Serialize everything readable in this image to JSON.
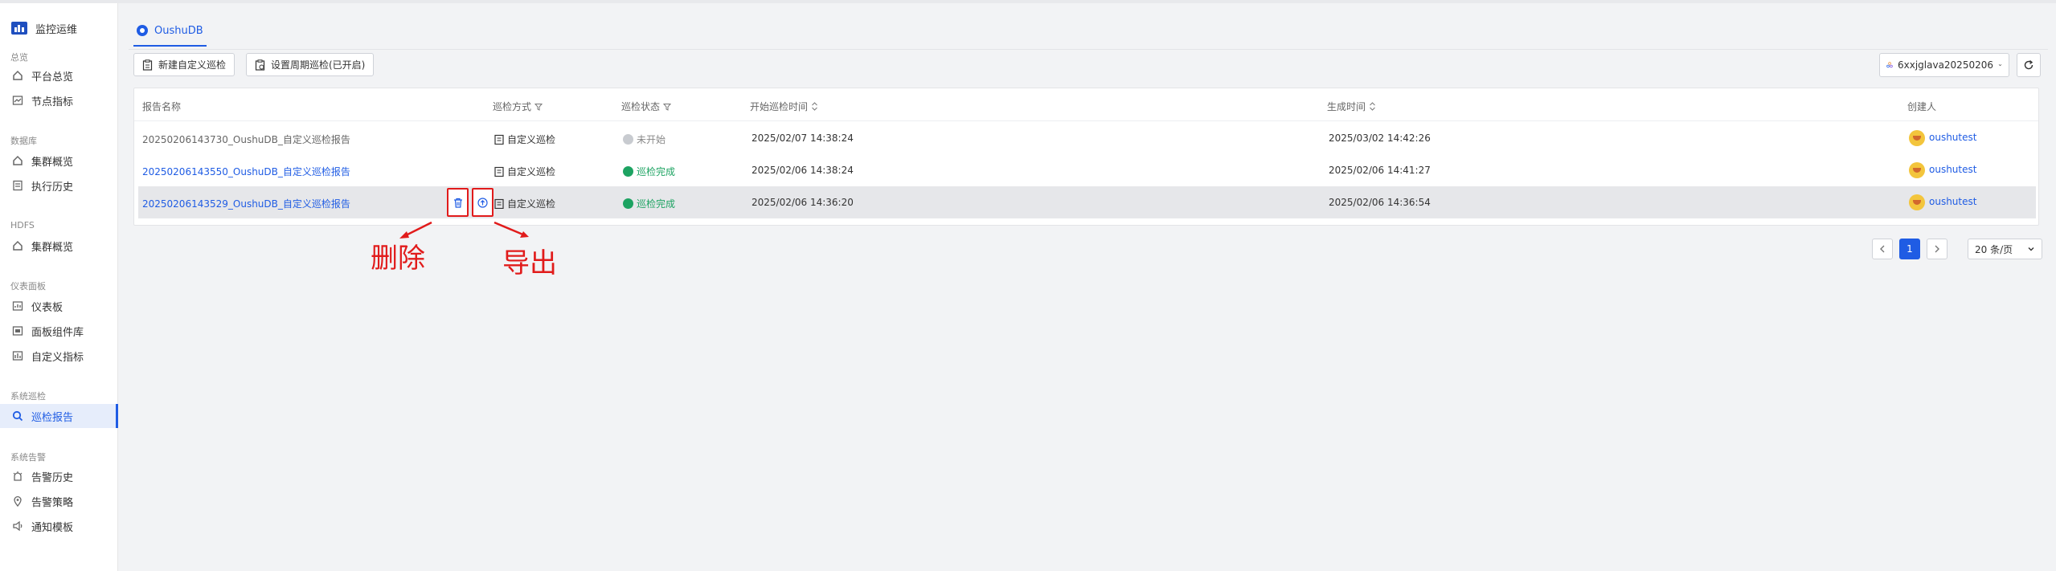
{
  "app": {
    "title": "监控运维"
  },
  "sidebar": {
    "groups": [
      {
        "label": "总览",
        "items": [
          {
            "label": "平台总览",
            "icon": "home-icon"
          },
          {
            "label": "节点指标",
            "icon": "chart-icon"
          }
        ]
      },
      {
        "label": "数据库",
        "items": [
          {
            "label": "集群概览",
            "icon": "home-icon"
          },
          {
            "label": "执行历史",
            "icon": "history-icon"
          }
        ]
      },
      {
        "label": "HDFS",
        "items": [
          {
            "label": "集群概览",
            "icon": "home-icon"
          }
        ]
      },
      {
        "label": "仪表面板",
        "items": [
          {
            "label": "仪表板",
            "icon": "dashboard-icon"
          },
          {
            "label": "面板组件库",
            "icon": "component-icon"
          },
          {
            "label": "自定义指标",
            "icon": "custom-metric-icon"
          }
        ]
      },
      {
        "label": "系统巡检",
        "items": [
          {
            "label": "巡检报告",
            "icon": "report-icon",
            "active": true
          }
        ]
      },
      {
        "label": "系统告警",
        "items": [
          {
            "label": "告警历史",
            "icon": "alert-history-icon"
          },
          {
            "label": "告警策略",
            "icon": "strategy-icon"
          },
          {
            "label": "通知模板",
            "icon": "notify-icon"
          }
        ]
      }
    ]
  },
  "tabs": [
    {
      "label": "OushuDB",
      "active": true
    }
  ],
  "toolbar": {
    "new_custom_label": "新建自定义巡检",
    "schedule_label": "设置周期巡检(已开启)",
    "cluster_value": "6xxjglava20250206"
  },
  "table": {
    "headers": {
      "name": "报告名称",
      "method": "巡检方式",
      "status": "巡检状态",
      "start_time": "开始巡检时间",
      "generated_time": "生成时间",
      "creator": "创建人"
    },
    "rows": [
      {
        "name": "20250206143730_OushuDB_自定义巡检报告",
        "method": "自定义巡检",
        "status": "未开始",
        "start_time": "2025/02/07 14:38:24",
        "generated_time": "2025/03/02 14:42:26",
        "creator": "oushutest"
      },
      {
        "name": "20250206143550_OushuDB_自定义巡检报告",
        "method": "自定义巡检",
        "status": "巡检完成",
        "start_time": "2025/02/06 14:38:24",
        "generated_time": "2025/02/06 14:41:27",
        "creator": "oushutest"
      },
      {
        "name": "20250206143529_OushuDB_自定义巡检报告",
        "method": "自定义巡检",
        "status": "巡检完成",
        "start_time": "2025/02/06 14:36:20",
        "generated_time": "2025/02/06 14:36:54",
        "creator": "oushutest"
      }
    ]
  },
  "annotations": {
    "delete": "删除",
    "export": "导出"
  },
  "pagination": {
    "current": "1",
    "page_size": "20 条/页"
  },
  "colors": {
    "accent": "#1f5ce4",
    "success": "#1da362",
    "annotation": "#e11b1b"
  }
}
